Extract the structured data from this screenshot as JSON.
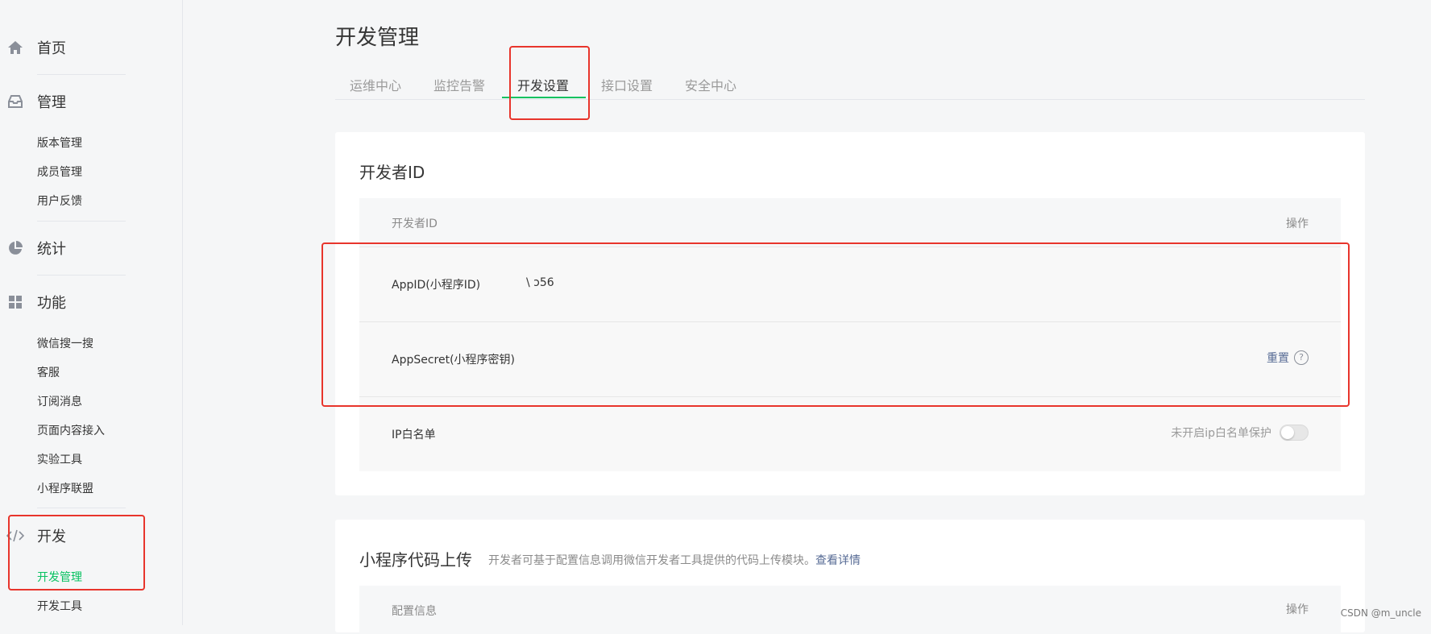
{
  "sidebar": {
    "home": {
      "label": "首页",
      "icon": "home-icon"
    },
    "manage": {
      "label": "管理",
      "icon": "inbox-icon",
      "items": [
        "版本管理",
        "成员管理",
        "用户反馈"
      ]
    },
    "stats": {
      "label": "统计",
      "icon": "pie-chart-icon"
    },
    "features": {
      "label": "功能",
      "icon": "grid-icon",
      "items": [
        "微信搜一搜",
        "客服",
        "订阅消息",
        "页面内容接入",
        "实验工具",
        "小程序联盟"
      ]
    },
    "dev": {
      "label": "开发",
      "icon": "code-icon",
      "items": [
        "开发管理",
        "开发工具"
      ],
      "active_item": "开发管理"
    }
  },
  "main": {
    "title": "开发管理",
    "tabs": [
      {
        "label": "运维中心"
      },
      {
        "label": "监控告警"
      },
      {
        "label": "开发设置",
        "active": true
      },
      {
        "label": "接口设置"
      },
      {
        "label": "安全中心"
      }
    ],
    "developer_card": {
      "title": "开发者ID",
      "col_name": "开发者ID",
      "col_action": "操作",
      "rows": [
        {
          "label": "AppID(小程序ID)",
          "value": "\\                       ɔ56",
          "action": ""
        },
        {
          "label": "AppSecret(小程序密钥)",
          "value": "",
          "action": "重置"
        },
        {
          "label": "IP白名单",
          "value": "",
          "status": "未开启ip白名单保护",
          "toggle_on": false
        }
      ]
    },
    "upload_card": {
      "title": "小程序代码上传",
      "desc": "开发者可基于配置信息调用微信开发者工具提供的代码上传模块。",
      "link": "查看详情",
      "col_name": "配置信息",
      "col_action": "操作"
    }
  },
  "watermark": "CSDN @m_uncle",
  "colors": {
    "accent": "#07c160",
    "link": "#576b95",
    "annotation": "#e8352c"
  }
}
